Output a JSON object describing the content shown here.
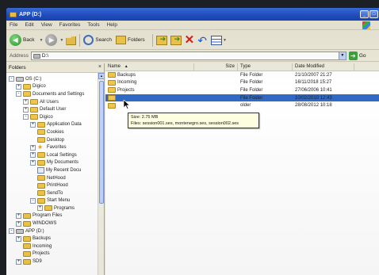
{
  "window": {
    "title": "APP (D:)"
  },
  "menu": [
    "File",
    "Edit",
    "View",
    "Favorites",
    "Tools",
    "Help"
  ],
  "toolbar": {
    "back": "Back",
    "search": "Search",
    "folders": "Folders"
  },
  "address": {
    "label": "Address",
    "value": "D:\\",
    "go": "Go"
  },
  "folders_pane": {
    "header": "Folders",
    "close": "×",
    "tree": [
      {
        "label": "OS (C:)",
        "level": 0,
        "expander": "-",
        "icon": "drive"
      },
      {
        "label": "Digico",
        "level": 1,
        "expander": "+",
        "icon": "folder"
      },
      {
        "label": "Documents and Settings",
        "level": 1,
        "expander": "-",
        "icon": "folder"
      },
      {
        "label": "All Users",
        "level": 2,
        "expander": "+",
        "icon": "folder"
      },
      {
        "label": "Default User",
        "level": 2,
        "expander": "+",
        "icon": "folder"
      },
      {
        "label": "Digico",
        "level": 2,
        "expander": "-",
        "icon": "folder"
      },
      {
        "label": "Application Data",
        "level": 3,
        "expander": "+",
        "icon": "folder"
      },
      {
        "label": "Cookies",
        "level": 3,
        "expander": "",
        "icon": "folder"
      },
      {
        "label": "Desktop",
        "level": 3,
        "expander": "",
        "icon": "folder"
      },
      {
        "label": "Favorites",
        "level": 3,
        "expander": "+",
        "icon": "star"
      },
      {
        "label": "Local Settings",
        "level": 3,
        "expander": "+",
        "icon": "folder"
      },
      {
        "label": "My Documents",
        "level": 3,
        "expander": "+",
        "icon": "folder"
      },
      {
        "label": "My Recent Docu",
        "level": 3,
        "expander": "",
        "icon": "doc"
      },
      {
        "label": "NetHood",
        "level": 3,
        "expander": "",
        "icon": "folder"
      },
      {
        "label": "PrintHood",
        "level": 3,
        "expander": "",
        "icon": "folder"
      },
      {
        "label": "SendTo",
        "level": 3,
        "expander": "",
        "icon": "folder"
      },
      {
        "label": "Start Menu",
        "level": 3,
        "expander": "-",
        "icon": "folder"
      },
      {
        "label": "Programs",
        "level": 4,
        "expander": "+",
        "icon": "folder"
      },
      {
        "label": "Program Files",
        "level": 1,
        "expander": "+",
        "icon": "folder"
      },
      {
        "label": "WINDOWS",
        "level": 1,
        "expander": "+",
        "icon": "folder"
      },
      {
        "label": "APP (D:)",
        "level": 0,
        "expander": "-",
        "icon": "drive"
      },
      {
        "label": "Backups",
        "level": 1,
        "expander": "+",
        "icon": "folder"
      },
      {
        "label": "Incoming",
        "level": 1,
        "expander": "",
        "icon": "folder"
      },
      {
        "label": "Projects",
        "level": 1,
        "expander": "",
        "icon": "folder"
      },
      {
        "label": "SD9",
        "level": 1,
        "expander": "+",
        "icon": "folder"
      }
    ]
  },
  "file_list": {
    "columns": {
      "name": "Name",
      "name_sort": "▲",
      "size": "Size",
      "type": "Type",
      "date": "Date Modified"
    },
    "rows": [
      {
        "name": "Backups",
        "type": "File Folder",
        "date": "21/10/2007 21:27"
      },
      {
        "name": "Incoming",
        "type": "File Folder",
        "date": "16/11/2018 15:27"
      },
      {
        "name": "Projects",
        "type": "File Folder",
        "date": "27/06/2006 10:41"
      },
      {
        "name": "",
        "type": "File Folder",
        "date": "10/02/2010 12:43"
      },
      {
        "name": "",
        "type": "older",
        "date": "28/08/2012 10:18"
      }
    ]
  },
  "tooltip": {
    "line1": "Size: 2.75 MB",
    "line2": "Files: session001.ses, montenegro.ses, session002.ses"
  }
}
